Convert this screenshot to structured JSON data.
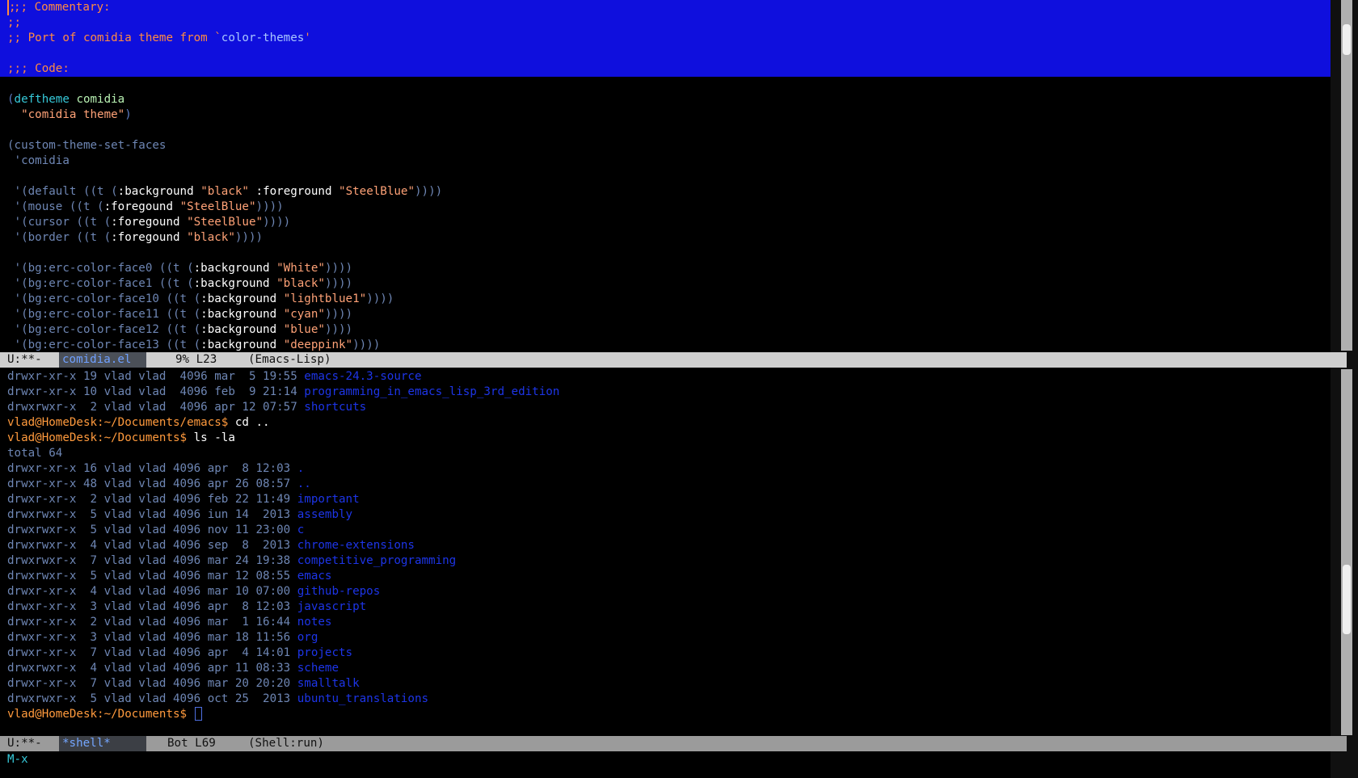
{
  "top_buffer": {
    "lines": [
      [
        {
          "t": ";;; Commentary:",
          "c": "comment"
        }
      ],
      [
        {
          "t": ";;",
          "c": "comment"
        }
      ],
      [
        {
          "t": ";; Port of comidia theme from `",
          "c": "comment"
        },
        {
          "t": "color-themes",
          "c": "quote"
        },
        {
          "t": "'",
          "c": "comment"
        }
      ],
      [],
      [
        {
          "t": ";;; Code:",
          "c": "comment"
        }
      ],
      [],
      [
        {
          "t": "(",
          "c": "paren"
        },
        {
          "t": "deftheme",
          "c": "kw"
        },
        {
          "t": " ",
          "c": "text"
        },
        {
          "t": "comidia",
          "c": "fn"
        }
      ],
      [
        {
          "t": "  ",
          "c": "text"
        },
        {
          "t": "\"comidia theme\"",
          "c": "string"
        },
        {
          "t": ")",
          "c": "paren"
        }
      ],
      [],
      [
        {
          "t": "(custom-theme-set-faces",
          "c": "text"
        }
      ],
      [
        {
          "t": " 'comidia",
          "c": "text"
        }
      ],
      [],
      [
        {
          "t": " '(default ((t (",
          "c": "text"
        },
        {
          "t": ":background",
          "c": "key"
        },
        {
          "t": " ",
          "c": "text"
        },
        {
          "t": "\"black\"",
          "c": "string"
        },
        {
          "t": " ",
          "c": "text"
        },
        {
          "t": ":foreground",
          "c": "key"
        },
        {
          "t": " ",
          "c": "text"
        },
        {
          "t": "\"SteelBlue\"",
          "c": "string"
        },
        {
          "t": "))))",
          "c": "text"
        }
      ],
      [
        {
          "t": " '(mouse ((t (",
          "c": "text"
        },
        {
          "t": ":foregound",
          "c": "key"
        },
        {
          "t": " ",
          "c": "text"
        },
        {
          "t": "\"SteelBlue\"",
          "c": "string"
        },
        {
          "t": "))))",
          "c": "text"
        }
      ],
      [
        {
          "t": " '(cursor ((t (",
          "c": "text"
        },
        {
          "t": ":foregound",
          "c": "key"
        },
        {
          "t": " ",
          "c": "text"
        },
        {
          "t": "\"SteelBlue\"",
          "c": "string"
        },
        {
          "t": "))))",
          "c": "text"
        }
      ],
      [
        {
          "t": " '(border ((t (",
          "c": "text"
        },
        {
          "t": ":foregound",
          "c": "key"
        },
        {
          "t": " ",
          "c": "text"
        },
        {
          "t": "\"black\"",
          "c": "string"
        },
        {
          "t": "))))",
          "c": "text"
        }
      ],
      [],
      [
        {
          "t": " '(bg:erc-color-face0 ((t (",
          "c": "text"
        },
        {
          "t": ":background",
          "c": "key"
        },
        {
          "t": " ",
          "c": "text"
        },
        {
          "t": "\"White\"",
          "c": "string"
        },
        {
          "t": "))))",
          "c": "text"
        }
      ],
      [
        {
          "t": " '(bg:erc-color-face1 ((t (",
          "c": "text"
        },
        {
          "t": ":background",
          "c": "key"
        },
        {
          "t": " ",
          "c": "text"
        },
        {
          "t": "\"black\"",
          "c": "string"
        },
        {
          "t": "))))",
          "c": "text"
        }
      ],
      [
        {
          "t": " '(bg:erc-color-face10 ((t (",
          "c": "text"
        },
        {
          "t": ":background",
          "c": "key"
        },
        {
          "t": " ",
          "c": "text"
        },
        {
          "t": "\"lightblue1\"",
          "c": "string"
        },
        {
          "t": "))))",
          "c": "text"
        }
      ],
      [
        {
          "t": " '(bg:erc-color-face11 ((t (",
          "c": "text"
        },
        {
          "t": ":background",
          "c": "key"
        },
        {
          "t": " ",
          "c": "text"
        },
        {
          "t": "\"cyan\"",
          "c": "string"
        },
        {
          "t": "))))",
          "c": "text"
        }
      ],
      [
        {
          "t": " '(bg:erc-color-face12 ((t (",
          "c": "text"
        },
        {
          "t": ":background",
          "c": "key"
        },
        {
          "t": " ",
          "c": "text"
        },
        {
          "t": "\"blue\"",
          "c": "string"
        },
        {
          "t": "))))",
          "c": "text"
        }
      ],
      [
        {
          "t": " '(bg:erc-color-face13 ((t (",
          "c": "text"
        },
        {
          "t": ":background",
          "c": "key"
        },
        {
          "t": " ",
          "c": "text"
        },
        {
          "t": "\"deeppink\"",
          "c": "string"
        },
        {
          "t": "))))",
          "c": "text"
        }
      ]
    ]
  },
  "top_modeline": {
    "status": "U:**-",
    "buffer": "comidia.el",
    "position": "9% L23",
    "mode": "(Emacs-Lisp)"
  },
  "bottom_buffer": {
    "lines": [
      [
        {
          "t": "drwxr-xr-x 19 vlad vlad  4096 mar  5 19:55 ",
          "c": "text"
        },
        {
          "t": "emacs-24.3-source",
          "c": "dir"
        }
      ],
      [
        {
          "t": "drwxr-xr-x 10 vlad vlad  4096 feb  9 21:14 ",
          "c": "text"
        },
        {
          "t": "programming_in_emacs_lisp_3rd_edition",
          "c": "dir"
        }
      ],
      [
        {
          "t": "drwxrwxr-x  2 vlad vlad  4096 apr 12 07:57 ",
          "c": "text"
        },
        {
          "t": "shortcuts",
          "c": "dir"
        }
      ],
      [
        {
          "t": "vlad@HomeDesk:~/Documents/emacs$ ",
          "c": "prompt"
        },
        {
          "t": "cd ..",
          "c": "cmd"
        }
      ],
      [
        {
          "t": "vlad@HomeDesk:~/Documents$ ",
          "c": "prompt"
        },
        {
          "t": "ls -la",
          "c": "cmd"
        }
      ],
      [
        {
          "t": "total 64",
          "c": "text"
        }
      ],
      [
        {
          "t": "drwxr-xr-x 16 vlad vlad 4096 apr  8 12:03 ",
          "c": "text"
        },
        {
          "t": ".",
          "c": "dir"
        }
      ],
      [
        {
          "t": "drwxr-xr-x 48 vlad vlad 4096 apr 26 08:57 ",
          "c": "text"
        },
        {
          "t": "..",
          "c": "dir"
        }
      ],
      [
        {
          "t": "drwxr-xr-x  2 vlad vlad 4096 feb 22 11:49 ",
          "c": "text"
        },
        {
          "t": "important",
          "c": "dir"
        }
      ],
      [
        {
          "t": "drwxrwxr-x  5 vlad vlad 4096 iun 14  2013 ",
          "c": "text"
        },
        {
          "t": "assembly",
          "c": "dir"
        }
      ],
      [
        {
          "t": "drwxrwxr-x  5 vlad vlad 4096 nov 11 23:00 ",
          "c": "text"
        },
        {
          "t": "c",
          "c": "dir"
        }
      ],
      [
        {
          "t": "drwxrwxr-x  4 vlad vlad 4096 sep  8  2013 ",
          "c": "text"
        },
        {
          "t": "chrome-extensions",
          "c": "dir"
        }
      ],
      [
        {
          "t": "drwxrwxr-x  7 vlad vlad 4096 mar 24 19:38 ",
          "c": "text"
        },
        {
          "t": "competitive_programming",
          "c": "dir"
        }
      ],
      [
        {
          "t": "drwxrwxr-x  5 vlad vlad 4096 mar 12 08:55 ",
          "c": "text"
        },
        {
          "t": "emacs",
          "c": "dir"
        }
      ],
      [
        {
          "t": "drwxr-xr-x  4 vlad vlad 4096 mar 10 07:00 ",
          "c": "text"
        },
        {
          "t": "github-repos",
          "c": "dir"
        }
      ],
      [
        {
          "t": "drwxr-xr-x  3 vlad vlad 4096 apr  8 12:03 ",
          "c": "text"
        },
        {
          "t": "javascript",
          "c": "dir"
        }
      ],
      [
        {
          "t": "drwxr-xr-x  2 vlad vlad 4096 mar  1 16:44 ",
          "c": "text"
        },
        {
          "t": "notes",
          "c": "dir"
        }
      ],
      [
        {
          "t": "drwxr-xr-x  3 vlad vlad 4096 mar 18 11:56 ",
          "c": "text"
        },
        {
          "t": "org",
          "c": "dir"
        }
      ],
      [
        {
          "t": "drwxr-xr-x  7 vlad vlad 4096 apr  4 14:01 ",
          "c": "text"
        },
        {
          "t": "projects",
          "c": "dir"
        }
      ],
      [
        {
          "t": "drwxrwxr-x  4 vlad vlad 4096 apr 11 08:33 ",
          "c": "text"
        },
        {
          "t": "scheme",
          "c": "dir"
        }
      ],
      [
        {
          "t": "drwxr-xr-x  7 vlad vlad 4096 mar 20 20:20 ",
          "c": "text"
        },
        {
          "t": "smalltalk",
          "c": "dir"
        }
      ],
      [
        {
          "t": "drwxrwxr-x  5 vlad vlad 4096 oct 25  2013 ",
          "c": "text"
        },
        {
          "t": "ubuntu_translations",
          "c": "dir"
        }
      ],
      [
        {
          "t": "vlad@HomeDesk:~/Documents$ ",
          "c": "prompt"
        }
      ]
    ]
  },
  "bottom_modeline": {
    "status": "U:**-",
    "buffer": "*shell*",
    "position": "Bot L69",
    "mode": "(Shell:run)"
  },
  "minibuffer": {
    "text": "M-x"
  },
  "colors": {
    "region_highlight": "#0f0fdd",
    "comment": "#ff8a42",
    "string": "#ffa277",
    "directory": "#1d35e8",
    "prompt": "#ff9a3d",
    "default_foreground": "#6e86b4"
  }
}
